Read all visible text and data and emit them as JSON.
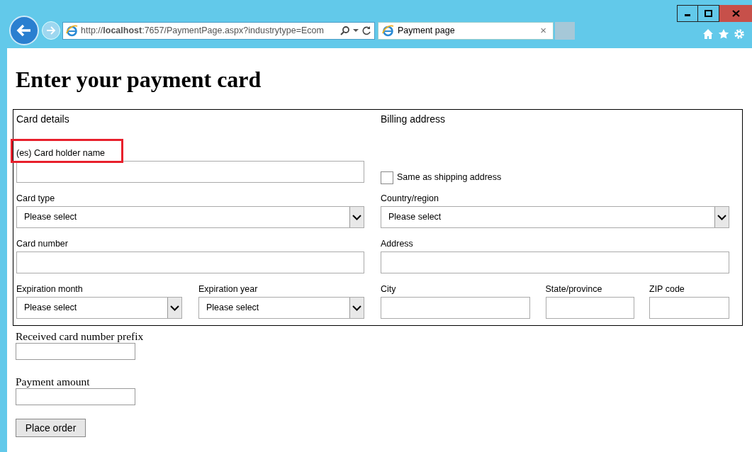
{
  "browser": {
    "url": "http://**localhost**:7657/PaymentPage.aspx?industrytype=Ecom",
    "tab": {
      "title": "Payment page",
      "close": "×"
    }
  },
  "heading": "Enter your payment card",
  "card_details": {
    "title": "Card details",
    "rows": [
      [
        {
          "kind": "text",
          "label": "(es) Card holder name",
          "highlighted": true
        }
      ],
      [
        {
          "kind": "select",
          "label": "Card type",
          "value": "Please select",
          "highlighted": false
        }
      ],
      [
        {
          "kind": "text",
          "label": "Card number",
          "highlighted": false
        }
      ],
      [
        {
          "kind": "select",
          "label": "Expiration month",
          "value": "Please select",
          "highlighted": false
        },
        {
          "kind": "select",
          "label": "Expiration year",
          "value": "Please select",
          "highlighted": false
        }
      ]
    ]
  },
  "billing_address": {
    "title": "Billing address",
    "rows": [
      [
        {
          "kind": "checkbox",
          "label": "Same as shipping address",
          "checked": false
        }
      ],
      [
        {
          "kind": "select",
          "label": "Country/region",
          "value": "Please select",
          "highlighted": false
        }
      ],
      [
        {
          "kind": "text",
          "label": "Address",
          "highlighted": false
        }
      ],
      [
        {
          "kind": "text",
          "label": "City",
          "highlighted": false
        },
        {
          "kind": "text",
          "label": "State/province",
          "highlighted": false
        },
        {
          "kind": "text",
          "label": "ZIP code",
          "highlighted": false
        }
      ]
    ]
  },
  "extra_fields": [
    {
      "label": "Received card number prefix"
    },
    {
      "label": "Payment amount"
    }
  ],
  "button": "Place order"
}
